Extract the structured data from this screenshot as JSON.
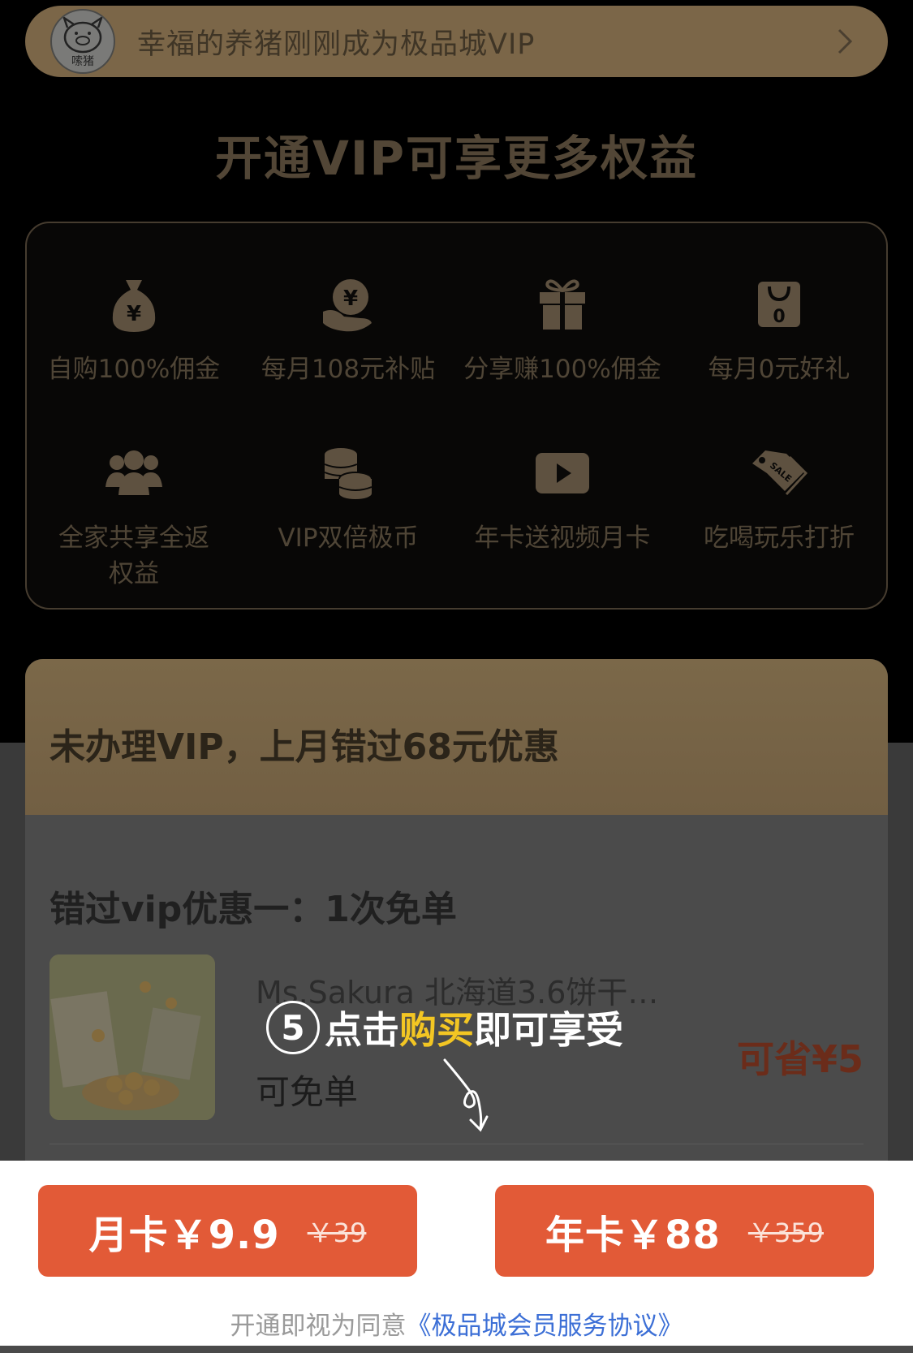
{
  "ticker": {
    "text": "幸福的养猪刚刚成为极品城VIP",
    "avatar_text": "嗦猪"
  },
  "headline": "开通VIP可享更多权益",
  "benefits": [
    {
      "icon": "money-bag-icon",
      "label": "自购100%佣金"
    },
    {
      "icon": "hand-coin-icon",
      "label": "每月108元补贴"
    },
    {
      "icon": "gift-icon",
      "label": "分享赚100%佣金"
    },
    {
      "icon": "shopping-bag-icon",
      "label": "每月0元好礼"
    },
    {
      "icon": "group-icon",
      "label": "全家共享全返权益"
    },
    {
      "icon": "coin-stack-icon",
      "label": "VIP双倍极币"
    },
    {
      "icon": "video-play-icon",
      "label": "年卡送视频月卡"
    },
    {
      "icon": "sale-tag-icon",
      "label": "吃喝玩乐打折"
    }
  ],
  "lost": {
    "title": "未办理VIP，上月错过68元优惠",
    "subtitle": "错过vip优惠一：1次免单",
    "product_name": "Ms.Sakura 北海道3.6饼干…",
    "free_label": "可免单",
    "save_label": "可省¥5"
  },
  "hint": {
    "step": "5",
    "pre": "点击",
    "highlight": "购买",
    "post": "即可享受"
  },
  "buttons": {
    "monthly": {
      "label": "月卡￥9.9",
      "original": "￥39"
    },
    "yearly": {
      "label": "年卡￥88",
      "original": "￥359"
    }
  },
  "agreement": {
    "prefix": "开通即视为同意",
    "link": "《极品城会员服务协议》"
  },
  "colors": {
    "button": "#e25a37",
    "highlight": "#f3c623",
    "link": "#3c6fd6"
  }
}
